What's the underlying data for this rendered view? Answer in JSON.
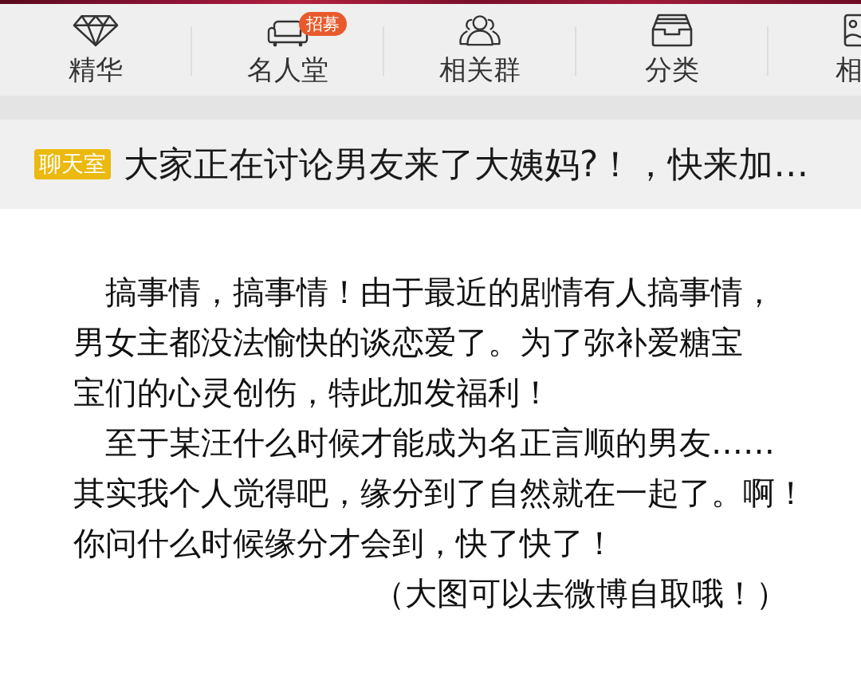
{
  "nav": {
    "items": [
      {
        "label": "精华"
      },
      {
        "label": "名人堂",
        "badge": "招募"
      },
      {
        "label": "相关群"
      },
      {
        "label": "分类"
      },
      {
        "label": "相"
      }
    ]
  },
  "chat_banner": {
    "tag": "聊天室",
    "text": "大家正在讨论男友来了大姨妈?！，快来加…"
  },
  "article": {
    "paragraphs": [
      {
        "kind": "body",
        "lines": [
          "搞事情，搞事情！由于最近的剧情有人搞事情，",
          "男女主都没法愉快的谈恋爱了。为了弥补爱糖宝",
          "宝们的心灵创伤，特此加发福利！"
        ]
      },
      {
        "kind": "body",
        "lines": [
          "至于某汪什么时候才能成为名正言顺的男友……",
          "其实我个人觉得吧，缘分到了自然就在一起了。啊！",
          "你问什么时候缘分才会到，快了快了！"
        ]
      },
      {
        "kind": "note",
        "lines": [
          "（大图可以去微博自取哦！）"
        ]
      }
    ]
  }
}
